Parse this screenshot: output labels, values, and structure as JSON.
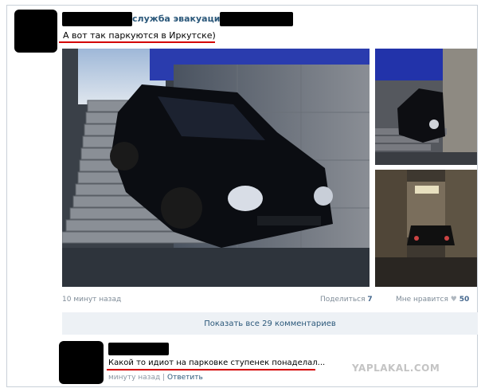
{
  "post": {
    "group_name_fragment": "служба эвакуации",
    "text": "А вот так паркуются в Иркутске)",
    "time": "10 минут назад",
    "share_label": "Поделиться",
    "share_count": "7",
    "like_label": "Мне нравится",
    "like_count": "50"
  },
  "comments_button": "Показать все 29 комментариев",
  "comment": {
    "text": "Какой то идиот на парковке ступенек понаделал...",
    "time": "минуту назад",
    "separator": "|",
    "reply_label": "Ответить"
  },
  "watermark": "YAPLAKAL.COM",
  "icons": {
    "like": "heart-icon"
  },
  "colors": {
    "link": "#2b587a",
    "meta": "#7f8c98",
    "highlight_underline": "#d40000"
  }
}
